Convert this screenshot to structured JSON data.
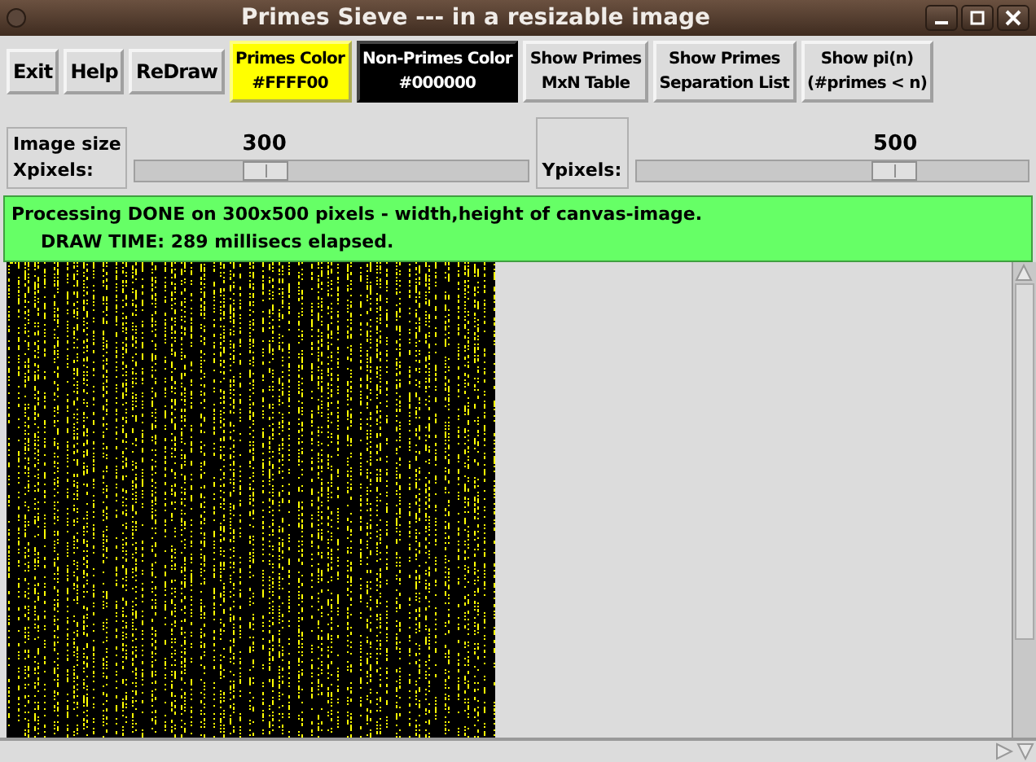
{
  "window": {
    "title": "Primes Sieve --- in a resizable image"
  },
  "buttons": [
    {
      "lines": [
        "Exit"
      ]
    },
    {
      "lines": [
        "Help"
      ]
    },
    {
      "lines": [
        "ReDraw"
      ]
    },
    {
      "lines": [
        "Primes Color",
        "#FFFF00"
      ],
      "color": "#ffff00"
    },
    {
      "lines": [
        "Non-Primes Color",
        "#000000"
      ],
      "color": "#000000"
    },
    {
      "lines": [
        "Show Primes",
        "MxN Table"
      ]
    },
    {
      "lines": [
        "Show Primes",
        "Separation List"
      ]
    },
    {
      "lines": [
        "Show pi(n)",
        "(#primes < n)"
      ]
    }
  ],
  "x_slider": {
    "label_lines": [
      "Image size",
      "Xpixels:"
    ],
    "reading": "300",
    "level": 0.33
  },
  "y_slider": {
    "label": "Ypixels:",
    "reading": "500",
    "level": 0.66
  },
  "status": {
    "lines": [
      "Processing DONE on 300x500 pixels - width,height of canvas-image.",
      "DRAW TIME: 289 millisecs elapsed."
    ]
  }
}
